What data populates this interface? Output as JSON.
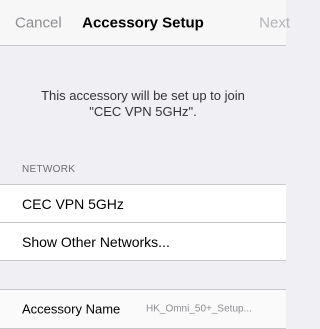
{
  "nav": {
    "cancel_label": "Cancel",
    "title": "Accessory Setup",
    "next_label": "Next"
  },
  "info": {
    "line1": "This accessory will be set up to join",
    "line2": "\"CEC VPN 5GHz\"."
  },
  "network_section": {
    "header": "NETWORK",
    "items": [
      {
        "label": "CEC VPN 5GHz"
      },
      {
        "label": "Show Other Networks..."
      }
    ]
  },
  "accessory": {
    "name_label": "Accessory Name",
    "name_value": "HK_Omni_50+_Setup..."
  },
  "colors": {
    "background": "#efeff4",
    "nav_bar": "#f7f7f7",
    "disabled_text": "#8e8e93",
    "separator": "#c8c7cc"
  }
}
